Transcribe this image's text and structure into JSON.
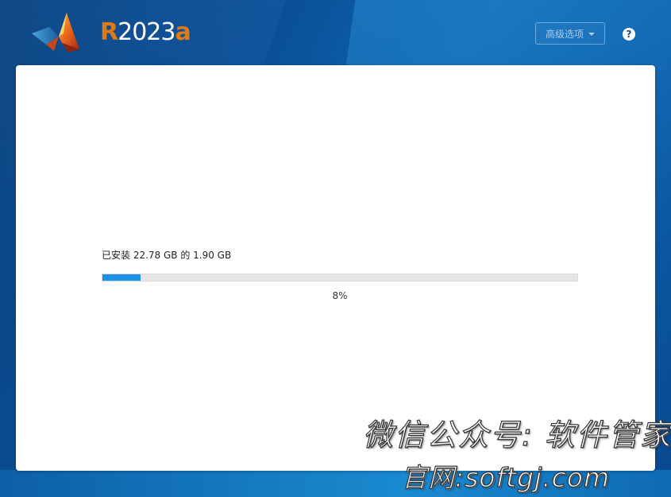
{
  "header": {
    "release": {
      "prefix": "R",
      "year": "2023",
      "suffix": "a"
    },
    "advanced_options_label": "高级选项",
    "help_label": "?"
  },
  "install": {
    "status_text": "已安装 22.78 GB 的 1.90 GB",
    "progress_fraction": 0.08,
    "percent_label": "8%"
  },
  "watermark": {
    "line1": "微信公众号: 软件管家",
    "line2": "官网:softgj.com"
  },
  "colors": {
    "release_accent": "#e07b12",
    "progress_fill": "#1c91e8",
    "progress_track": "#e6e6e6",
    "background_primary": "#0a4d94"
  },
  "icons": {
    "logo": "matlab-membrane-logo-icon",
    "dropdown": "caret-down-icon",
    "help": "question-circle-icon"
  }
}
